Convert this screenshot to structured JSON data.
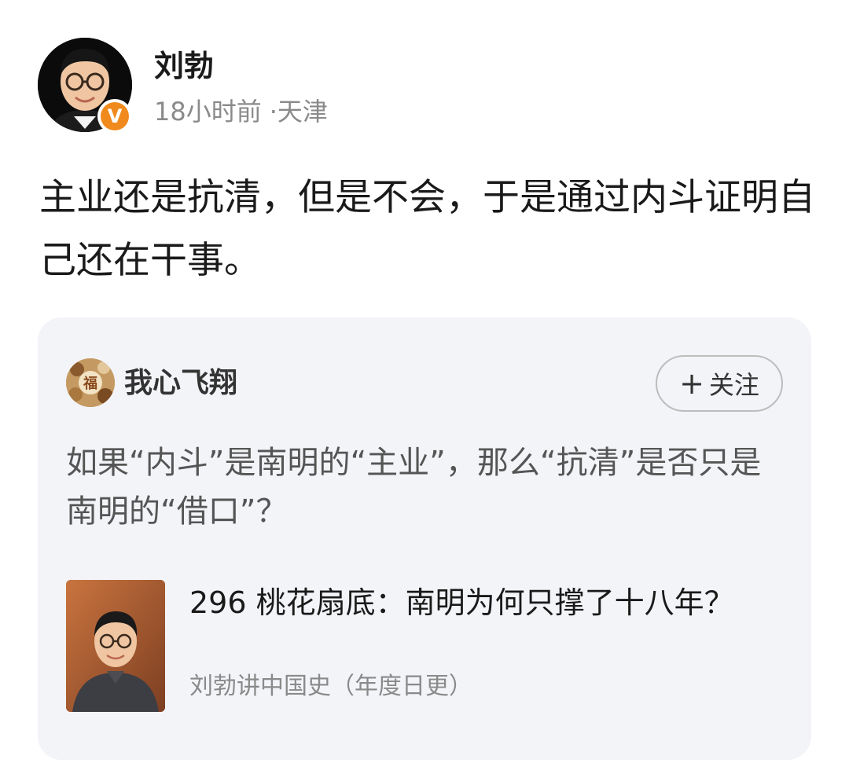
{
  "author": {
    "name": "刘勃",
    "time": "18小时前",
    "location": "·天津",
    "badge": "V"
  },
  "post": {
    "text": "主业还是抗清，但是不会，于是通过内斗证明自己还在干事。"
  },
  "quote": {
    "user_name": "我心飞翔",
    "follow_label": "关注",
    "follow_icon": "plus-icon",
    "text": "如果“内斗”是南明的“主业”，那么“抗清”是否只是南明的“借口”？",
    "article": {
      "title": "296 桃花扇底：南明为何只撑了十八年？",
      "source": "刘勃讲中国史（年度日更）"
    }
  },
  "colors": {
    "badge": "#f08a1c",
    "card_bg": "#f3f4f8",
    "meta_text": "#8a8a8a"
  }
}
